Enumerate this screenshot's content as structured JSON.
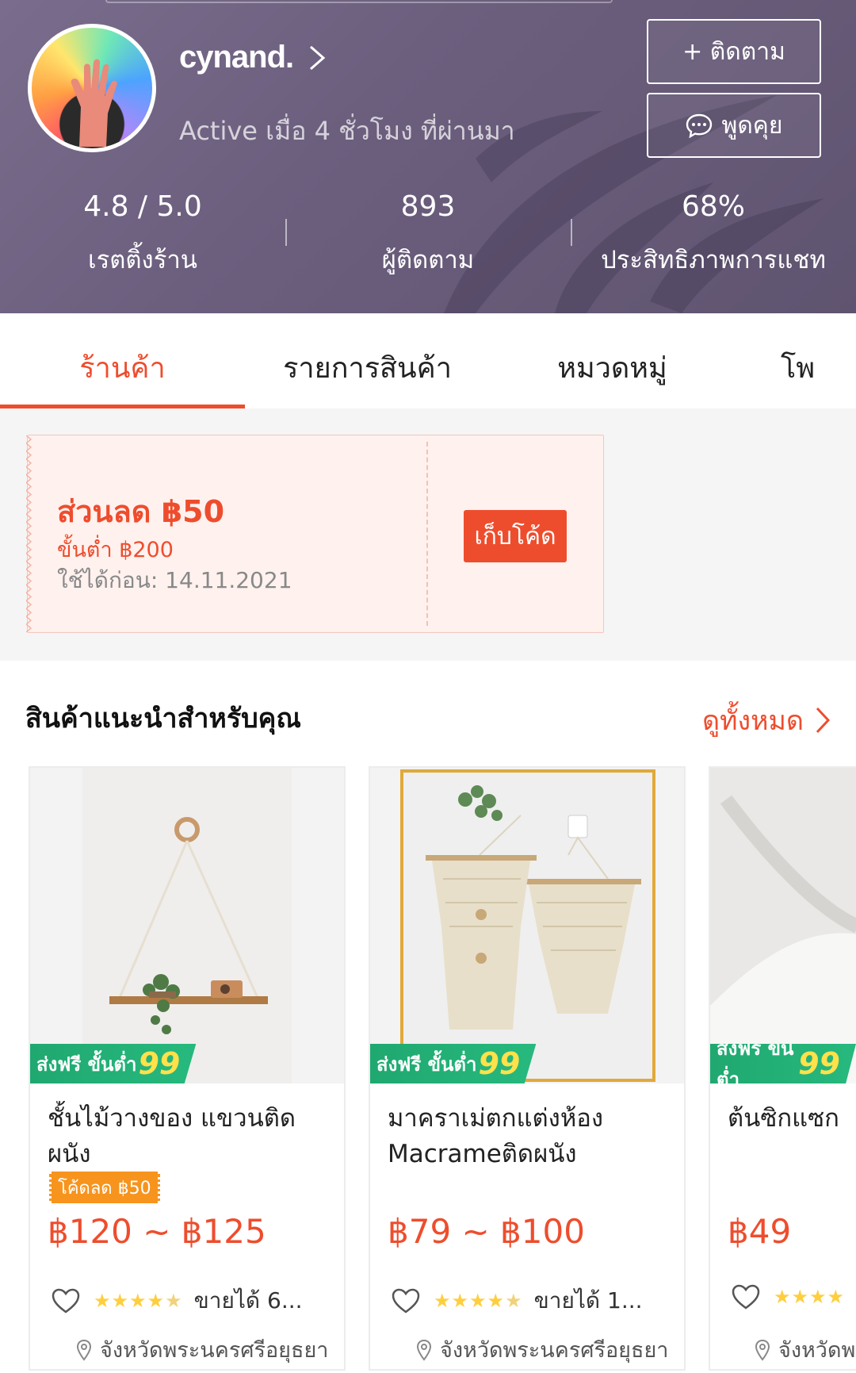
{
  "shop": {
    "name": "cynand.",
    "active": "Active เมื่อ 4 ชั่วโมง ที่ผ่านมา",
    "follow_label": "+ ติดตาม",
    "chat_label": "พูดคุย"
  },
  "stats": [
    {
      "value": "4.8 / 5.0",
      "label": "เรตติ้งร้าน"
    },
    {
      "value": "893",
      "label": "ผู้ติดตาม"
    },
    {
      "value": "68%",
      "label": "ประสิทธิภาพการแชท"
    }
  ],
  "tabs": [
    "ร้านค้า",
    "รายการสินค้า",
    "หมวดหมู่",
    "โพ"
  ],
  "voucher": {
    "title": "ส่วนลด ฿50",
    "min": "ขั้นต่ำ ฿200",
    "expiry": "ใช้ได้ก่อน: 14.11.2021",
    "button": "เก็บโค้ด"
  },
  "recommended": {
    "title": "สินค้าแนะนำสำหรับคุณ",
    "see_all": "ดูทั้งหมด",
    "products": [
      {
        "badge_text": "ส่งฟรี ขั้นต่ำ",
        "badge_num": "99",
        "name": "ชั้นไม้วางของ แขวนติดผนัง",
        "tag": "โค้ดลด ฿50",
        "price": "฿120 ~ ฿125",
        "sold": "ขายได้ 6...",
        "location": "จังหวัดพระนครศรีอยุธยา"
      },
      {
        "badge_text": "ส่งฟรี ขั้นต่ำ",
        "badge_num": "99",
        "name": "มาคราเม่ตกแต่งห้อง Macrameติดผนัง",
        "tag": "",
        "price": "฿79 ~ ฿100",
        "sold": "ขายได้ 1...",
        "location": "จังหวัดพระนครศรีอยุธยา"
      },
      {
        "badge_text": "ส่งฟรี ขั้นต่ำ",
        "badge_num": "99",
        "name": "ต้นซิกแซก ก",
        "tag": "",
        "price": "฿49",
        "sold": "",
        "location": "จังหวัดพ"
      }
    ]
  },
  "colors": {
    "accent": "#ee4d2d",
    "star": "#ffce3d",
    "ship_badge": "#1fa870"
  }
}
